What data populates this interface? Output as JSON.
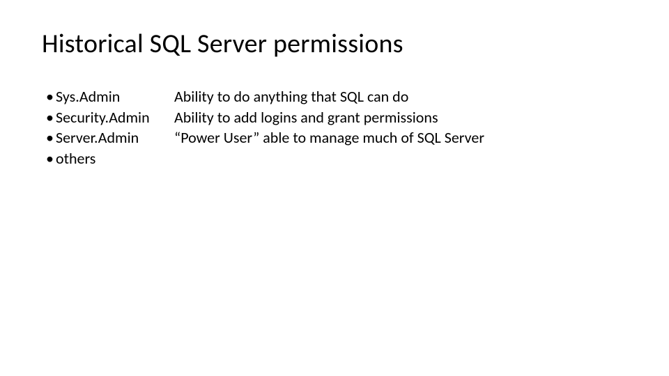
{
  "title": "Historical SQL Server permissions",
  "bullet": "•",
  "left": [
    "Sys.Admin",
    "Security.Admin",
    "Server.Admin",
    "others"
  ],
  "right": [
    "Ability to do anything that SQL can do",
    "Ability to add logins and grant permissions",
    "“Power User” able to manage much of SQL Server",
    ""
  ]
}
